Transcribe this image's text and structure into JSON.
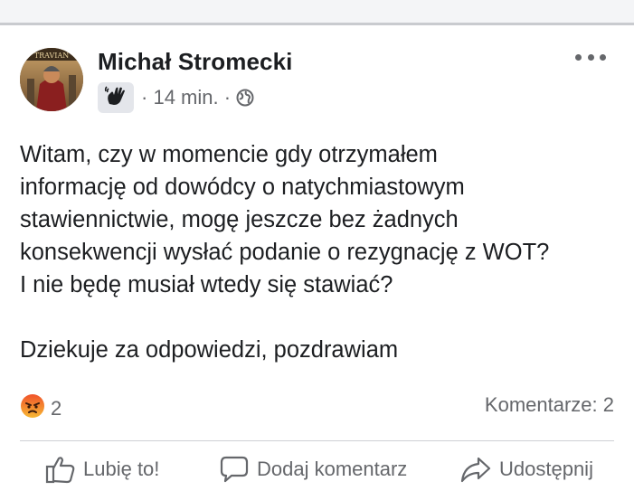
{
  "post": {
    "author": "Michał Stromecki",
    "time": "14 min.",
    "body_lines": [
      "Witam, czy w momencie gdy otrzymałem",
      "informację od dowódcy o natychmiastowym",
      "stawiennictwie, mogę jeszcze bez żadnych",
      "konsekwencji wysłać podanie o rezygnację z WOT?",
      "I nie będę musiał wtedy się stawiać?"
    ],
    "closing": "Dziekuje za odpowiedzi, pozdrawiam",
    "avatar_text": "TRAVIAN"
  },
  "reactions": {
    "count": "2",
    "icon": "angry-face-icon"
  },
  "comments_label": "Komentarze: 2",
  "actions": {
    "like": "Lubię to!",
    "comment": "Dodaj komentarz",
    "share": "Udostępnij"
  },
  "colors": {
    "text": "#1c1e21",
    "secondary": "#65676b",
    "angry": "#f05a28",
    "divider": "#ced0d4"
  }
}
